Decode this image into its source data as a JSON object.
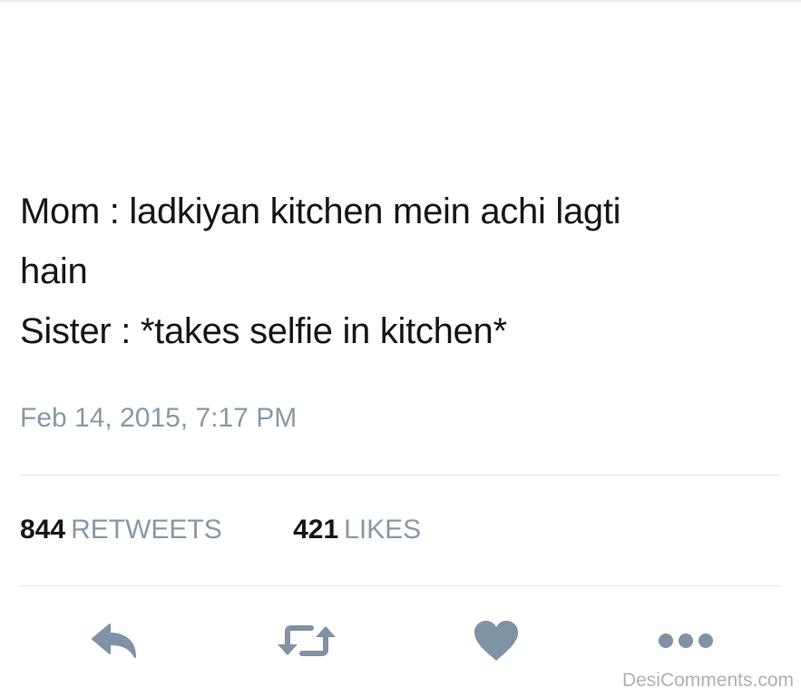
{
  "tweet": {
    "text_lines": [
      "Mom : ladkiyan kitchen mein achi lagti",
      "hain",
      "Sister : *takes selfie in kitchen*"
    ],
    "timestamp": "Feb 14, 2015, 7:17 PM"
  },
  "stats": {
    "retweets_count": "844",
    "retweets_label": "RETWEETS",
    "likes_count": "421",
    "likes_label": "LIKES"
  },
  "actions": {
    "icon_color": "#7f92a6",
    "items": [
      {
        "icon": "reply-icon"
      },
      {
        "icon": "retweet-icon"
      },
      {
        "icon": "heart-icon"
      },
      {
        "icon": "more-icon"
      }
    ]
  },
  "watermark": "DesiComments.com"
}
